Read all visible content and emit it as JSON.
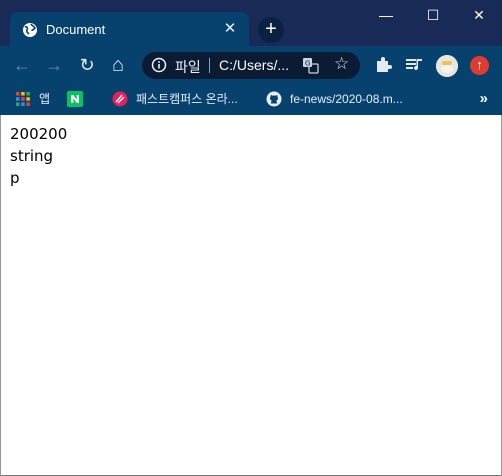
{
  "tab": {
    "title": "Document",
    "close_glyph": "✕"
  },
  "window_controls": {
    "minimize": "—",
    "maximize": "☐",
    "close": "✕"
  },
  "toolbar": {
    "back": "←",
    "forward": "→",
    "reload": "↻",
    "home": "⌂",
    "omnibox": {
      "scheme_label": "파일",
      "url": "C:/Users/..."
    },
    "star": "☆",
    "update_glyph": "↑"
  },
  "bookmarks": {
    "items": [
      {
        "label": "앱",
        "icon": "apps-grid-icon"
      },
      {
        "label": "",
        "icon": "naver-icon"
      },
      {
        "label": "패스트캠퍼스 온라...",
        "icon": "fastcampus-icon"
      },
      {
        "label": "fe-news/2020-08.m...",
        "icon": "github-icon"
      }
    ],
    "more": "»"
  },
  "content": {
    "lines": [
      "200200",
      "string",
      "p"
    ]
  },
  "colors": {
    "titlebar": "#182a55",
    "toolbar": "#07416e",
    "omnibox": "#0a1b33",
    "update_badge": "#e03b2f",
    "naver": "#03c75a"
  }
}
